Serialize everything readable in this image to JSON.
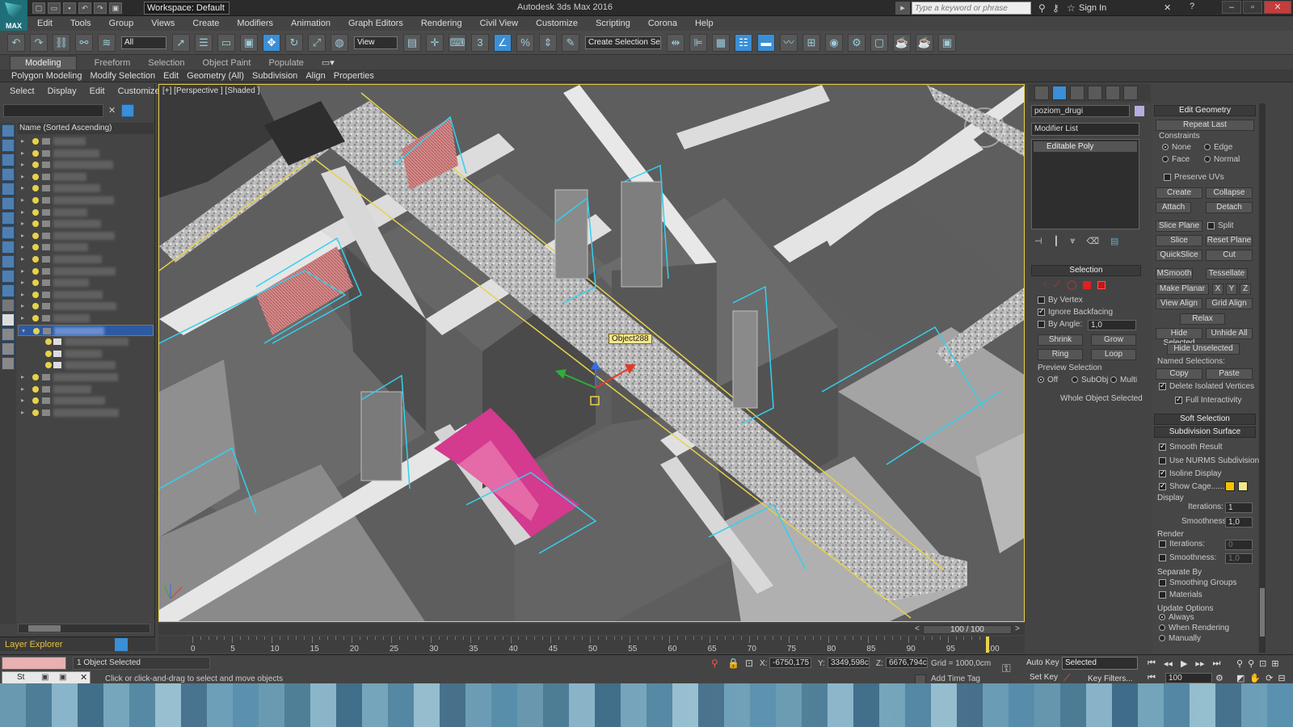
{
  "title": {
    "workspace": "Workspace: Default",
    "app_title": "Autodesk 3ds Max 2016",
    "search_placeholder": "Type a keyword or phrase",
    "sign_in": "Sign In",
    "logo": "MAX"
  },
  "menu": [
    "Edit",
    "Tools",
    "Group",
    "Views",
    "Create",
    "Modifiers",
    "Animation",
    "Graph Editors",
    "Rendering",
    "Civil View",
    "Customize",
    "Scripting",
    "Corona",
    "Help"
  ],
  "toolbar": {
    "filter": "All",
    "refcoord": "View",
    "selset": "Create Selection Se"
  },
  "ribbon": {
    "tabs": [
      "Modeling",
      "Freeform",
      "Selection",
      "Object Paint",
      "Populate"
    ],
    "subtabs": [
      "Polygon Modeling",
      "Modify Selection",
      "Edit",
      "Geometry (All)",
      "Subdivision",
      "Align",
      "Properties"
    ]
  },
  "scene_explorer": {
    "tabs": [
      "Select",
      "Display",
      "Edit",
      "Customize"
    ],
    "header": "Name (Sorted Ascending)",
    "footer": "Layer Explorer"
  },
  "viewport": {
    "label": "[+] [Perspective ] [Shaded ]",
    "tooltip": "Object288"
  },
  "command_panel": {
    "object_name": "poziom_drugi",
    "modifier_list": "Modifier List",
    "stack_item": "Editable Poly",
    "selection": {
      "header": "Selection",
      "by_vertex": "By Vertex",
      "ignore_backfacing": "Ignore Backfacing",
      "by_angle": "By Angle:",
      "angle": "1,0",
      "shrink": "Shrink",
      "grow": "Grow",
      "ring": "Ring",
      "loop": "Loop",
      "preview": "Preview Selection",
      "off": "Off",
      "subobj": "SubObj",
      "multi": "Multi",
      "status": "Whole Object Selected"
    },
    "edit_geometry": {
      "header": "Edit Geometry",
      "repeat_last": "Repeat Last",
      "constraints": "Constraints",
      "none": "None",
      "edge": "Edge",
      "face": "Face",
      "normal": "Normal",
      "preserve_uvs": "Preserve UVs",
      "create": "Create",
      "collapse": "Collapse",
      "attach": "Attach",
      "detach": "Detach",
      "slice_plane": "Slice Plane",
      "split": "Split",
      "slice": "Slice",
      "reset_plane": "Reset Plane",
      "quickslice": "QuickSlice",
      "cut": "Cut",
      "msmooth": "MSmooth",
      "tessellate": "Tessellate",
      "make_planar": "Make Planar",
      "x": "X",
      "y": "Y",
      "z": "Z",
      "view_align": "View Align",
      "grid_align": "Grid Align",
      "relax": "Relax",
      "hide_selected": "Hide Selected",
      "unhide_all": "Unhide All",
      "hide_unselected": "Hide Unselected",
      "named_sel": "Named Selections:",
      "copy": "Copy",
      "paste": "Paste",
      "delete_iso": "Delete Isolated Vertices",
      "full_inter": "Full Interactivity"
    },
    "soft_selection": "Soft Selection",
    "subdivision": {
      "header": "Subdivision Surface",
      "smooth_result": "Smooth Result",
      "use_nurms": "Use NURMS Subdivision",
      "isoline": "Isoline Display",
      "show_cage": "Show Cage......",
      "display": "Display",
      "iterations": "Iterations:",
      "iter_val": "1",
      "smoothness": "Smoothness:",
      "smooth_val": "1,0",
      "render": "Render",
      "r_iter_val": "0",
      "r_smooth_val": "1,0",
      "separate_by": "Separate By",
      "smoothing_groups": "Smoothing Groups",
      "materials": "Materials",
      "update_options": "Update Options",
      "always": "Always",
      "when_rendering": "When Rendering",
      "manually": "Manually"
    }
  },
  "timeline": {
    "slider": "100 / 100",
    "ticks": [
      "0",
      "5",
      "10",
      "15",
      "20",
      "25",
      "30",
      "35",
      "40",
      "45",
      "50",
      "55",
      "60",
      "65",
      "70",
      "75",
      "80",
      "85",
      "90",
      "95",
      "100"
    ]
  },
  "status": {
    "selected": "1 Object Selected",
    "prompt": "Click or click-and-drag to select and move objects",
    "x_label": "X:",
    "x": "-6750,175",
    "y_label": "Y:",
    "y": "3349,598c",
    "z_label": "Z:",
    "z": "6676,794c",
    "grid": "Grid = 1000,0cm",
    "add_time_tag": "Add Time Tag",
    "auto_key": "Auto Key",
    "set_key": "Set Key",
    "key_mode": "Selected",
    "key_filters": "Key Filters...",
    "frame": "100",
    "script_mini": "St"
  },
  "colors": {
    "viewport_border": "#e6d24a",
    "accent": "#3a8fd6",
    "cage1": "#f4c400",
    "cage2": "#f0e68c"
  }
}
